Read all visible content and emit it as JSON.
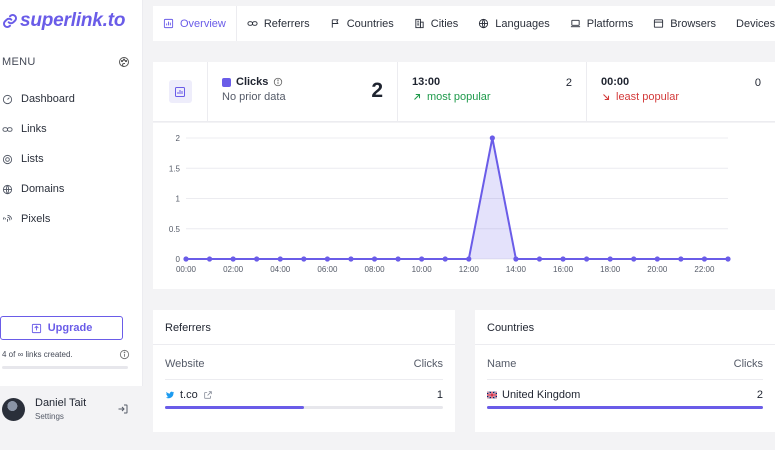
{
  "brand": {
    "logo_text": "superlink.to",
    "accent": "#6a5ce8"
  },
  "sidebar": {
    "menu_label": "MENU",
    "items": [
      {
        "label": "Dashboard",
        "icon": "gauge-icon"
      },
      {
        "label": "Links",
        "icon": "link-icon"
      },
      {
        "label": "Lists",
        "icon": "target-icon"
      },
      {
        "label": "Domains",
        "icon": "globe-icon"
      },
      {
        "label": "Pixels",
        "icon": "fingerprint-icon"
      }
    ],
    "upgrade_label": "Upgrade",
    "usage_text": "4 of ∞ links created.",
    "user": {
      "name": "Daniel Tait",
      "subtitle": "Settings"
    }
  },
  "tabs": [
    {
      "label": "Overview",
      "icon": "chart-icon",
      "active": true
    },
    {
      "label": "Referrers",
      "icon": "link-icon"
    },
    {
      "label": "Countries",
      "icon": "flag-icon"
    },
    {
      "label": "Cities",
      "icon": "building-icon"
    },
    {
      "label": "Languages",
      "icon": "globe-icon"
    },
    {
      "label": "Platforms",
      "icon": "laptop-icon"
    },
    {
      "label": "Browsers",
      "icon": "window-icon"
    },
    {
      "label": "Devices",
      "icon": "device-icon"
    }
  ],
  "stats": {
    "clicks_label": "Clicks",
    "clicks_sub": "No prior data",
    "clicks_value": "2",
    "most_popular_time": "13:00",
    "most_popular_count": "2",
    "most_popular_label": "most popular",
    "least_popular_time": "00:00",
    "least_popular_count": "0",
    "least_popular_label": "least popular"
  },
  "chart_data": {
    "type": "area",
    "x": [
      "00:00",
      "01:00",
      "02:00",
      "03:00",
      "04:00",
      "05:00",
      "06:00",
      "07:00",
      "08:00",
      "09:00",
      "10:00",
      "11:00",
      "12:00",
      "13:00",
      "14:00",
      "15:00",
      "16:00",
      "17:00",
      "18:00",
      "19:00",
      "20:00",
      "21:00",
      "22:00",
      "23:00"
    ],
    "tick_labels": [
      "00:00",
      "02:00",
      "04:00",
      "06:00",
      "08:00",
      "10:00",
      "12:00",
      "14:00",
      "16:00",
      "18:00",
      "20:00",
      "22:00"
    ],
    "series": [
      {
        "values": [
          0,
          0,
          0,
          0,
          0,
          0,
          0,
          0,
          0,
          0,
          0,
          0,
          0,
          2,
          0,
          0,
          0,
          0,
          0,
          0,
          0,
          0,
          0,
          0
        ]
      }
    ],
    "y_ticks": [
      "0",
      "0.5",
      "1",
      "1.5",
      "2"
    ],
    "ylim": [
      0,
      2
    ],
    "grid": true,
    "color": "#6a5ce8"
  },
  "referrers": {
    "title": "Referrers",
    "col1": "Website",
    "col2": "Clicks",
    "rows": [
      {
        "name": "t.co",
        "clicks": "1",
        "share": 0.5,
        "icon": "twitter-icon"
      }
    ]
  },
  "countries": {
    "title": "Countries",
    "col1": "Name",
    "col2": "Clicks",
    "rows": [
      {
        "name": "United Kingdom",
        "clicks": "2",
        "share": 1.0,
        "icon": "uk-flag-icon"
      }
    ]
  }
}
